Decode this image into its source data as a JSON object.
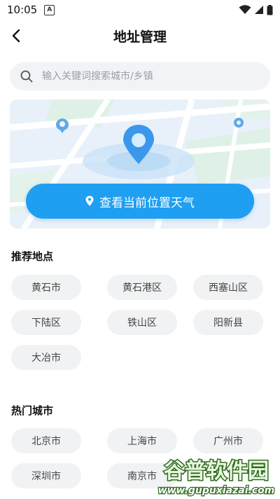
{
  "status_bar": {
    "time": "10:05",
    "notification_letter": "A"
  },
  "header": {
    "title": "地址管理"
  },
  "search": {
    "placeholder": "输入关键词搜索城市/乡镇",
    "value": ""
  },
  "map": {
    "locate_button_label": "查看当前位置天气"
  },
  "recommended": {
    "title": "推荐地点",
    "items": [
      "黄石市",
      "黄石港区",
      "西塞山区",
      "下陆区",
      "铁山区",
      "阳新县",
      "大冶市"
    ]
  },
  "hot_cities": {
    "title": "热门城市",
    "items": [
      "北京市",
      "上海市",
      "广州市",
      "深圳市",
      "南京市"
    ]
  },
  "watermark": {
    "title": "谷普软件园",
    "url": "www.gupuxiazai.com"
  },
  "colors": {
    "accent": "#1e9ff2",
    "chip_bg": "#f1f2f4",
    "search_bg": "#f1f3f6"
  }
}
